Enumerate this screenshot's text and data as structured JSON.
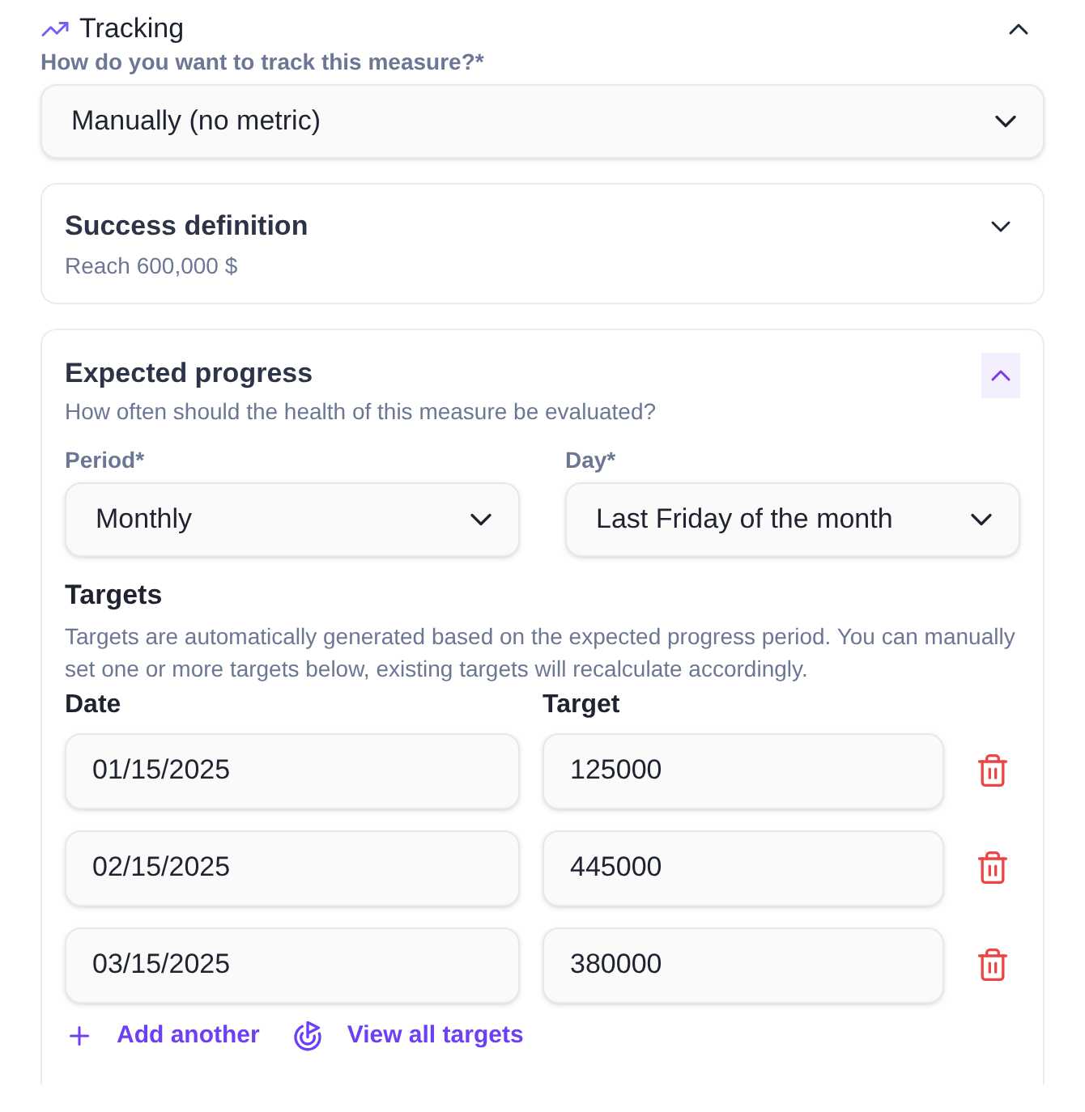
{
  "tracking": {
    "title": "Tracking",
    "expanded": true,
    "question": "How do you want to track this measure?*",
    "value": "Manually (no metric)"
  },
  "success_definition": {
    "title": "Success definition",
    "expanded": false,
    "summary": "Reach 600,000 $"
  },
  "expected_progress": {
    "title": "Expected progress",
    "expanded": true,
    "subtitle": "How often should the health of this measure be evaluated?",
    "fields": [
      {
        "label": "Period*",
        "value": "Monthly"
      },
      {
        "label": "Day*",
        "value": "Last Friday of the month"
      }
    ],
    "targets": {
      "title": "Targets",
      "description": "Targets are automatically generated based on the expected progress period. You can manually set one or more targets below, existing targets will recalculate accordingly.",
      "columns": [
        "Date",
        "Target"
      ],
      "rows": [
        {
          "date": "01/15/2025",
          "target": "125000"
        },
        {
          "date": "02/15/2025",
          "target": "445000"
        },
        {
          "date": "03/15/2025",
          "target": "380000"
        }
      ]
    },
    "actions": [
      "Add another",
      "View all targets"
    ]
  }
}
